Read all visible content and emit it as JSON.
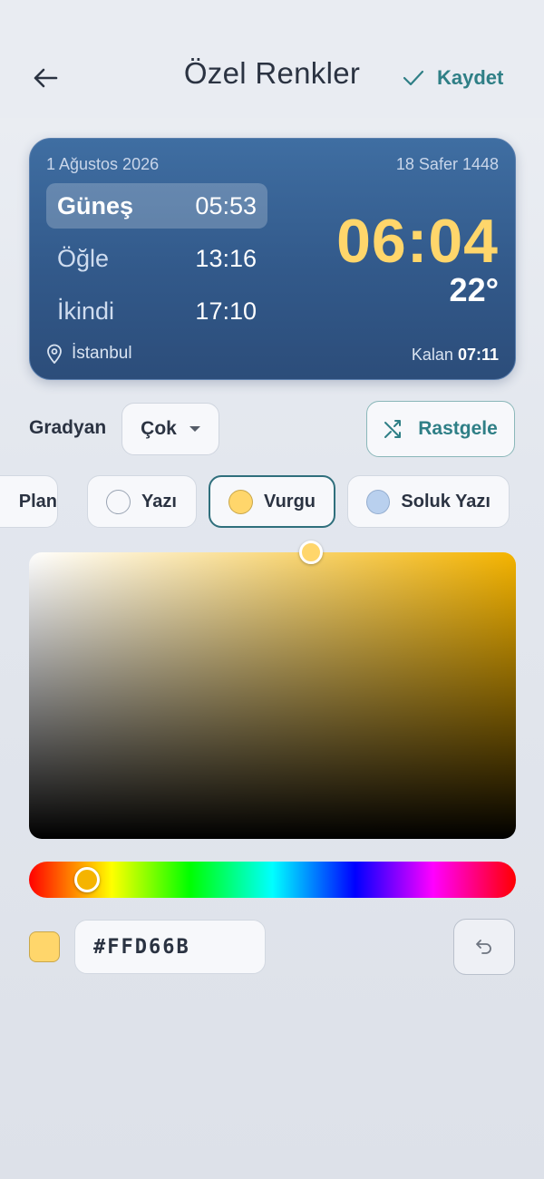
{
  "header": {
    "title": "Özel Renkler",
    "save_label": "Kaydet"
  },
  "card": {
    "date_gregorian": "1 Ağustos 2026",
    "date_hijri": "18 Safer 1448",
    "prayers": [
      {
        "name": "Güneş",
        "time": "05:53",
        "active": true
      },
      {
        "name": "Öğle",
        "time": "13:16",
        "active": false
      },
      {
        "name": "İkindi",
        "time": "17:10",
        "active": false
      }
    ],
    "current_time": "06:04",
    "temperature": "22°",
    "location": "İstanbul",
    "remaining_label": "Kalan",
    "remaining_value": "07:11"
  },
  "gradient": {
    "label": "Gradyan",
    "selected_option": "Çok"
  },
  "random_label": "Rastgele",
  "chips": [
    {
      "label": "Plan",
      "color": null
    },
    {
      "label": "Yazı",
      "color": "#f7f8fb"
    },
    {
      "label": "Vurgu",
      "color": "#ffd66b",
      "selected": true
    },
    {
      "label": "Soluk Yazı",
      "color": "#b9d0ee"
    }
  ],
  "picker": {
    "hex_value": "#FFD66B",
    "current_color": "#ffd66b",
    "hue_color": "#f5b400"
  },
  "colors": {
    "accent": "#2f7f86",
    "card_top": "#3f6ea2",
    "card_bottom": "#2c4d7a",
    "highlight": "#ffd66b"
  },
  "icons": {
    "back": "arrow-left-icon",
    "save": "check-icon",
    "location": "map-pin-icon",
    "random": "shuffle-icon",
    "dropdown": "caret-down-icon",
    "undo": "undo-icon"
  }
}
